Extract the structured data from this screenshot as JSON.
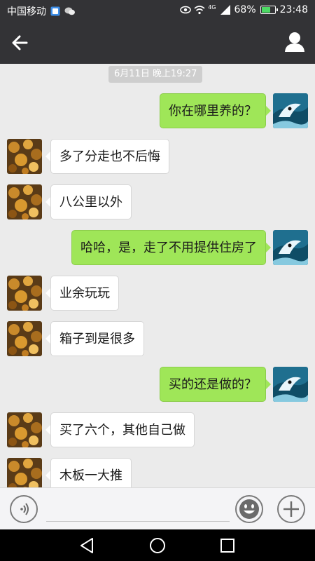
{
  "status_bar": {
    "carrier": "中国移动",
    "network": "4G",
    "battery": "68%",
    "battery_level": 0.68,
    "time": "23:48"
  },
  "header": {
    "contact_name": "",
    "icons": [
      "back-arrow-icon",
      "profile-icon"
    ]
  },
  "chat": {
    "timestamp": "6月11日 晚上19:27",
    "messages": [
      {
        "dir": "out",
        "text": "你在哪里养的？"
      },
      {
        "dir": "in",
        "text": "多了分走也不后悔"
      },
      {
        "dir": "in",
        "text": "八公里以外"
      },
      {
        "dir": "out",
        "text": "哈哈，是，走了不用提供住房了"
      },
      {
        "dir": "in",
        "text": "业余玩玩"
      },
      {
        "dir": "in",
        "text": "箱子到是很多"
      },
      {
        "dir": "out",
        "text": "买的还是做的？"
      },
      {
        "dir": "in",
        "text": "买了六个，其他自己做"
      },
      {
        "dir": "in",
        "text": "木板一大推"
      }
    ]
  },
  "input_bar": {
    "value": "",
    "icons": [
      "voice-icon",
      "emoji-icon",
      "plus-icon"
    ]
  },
  "nav_bar": {
    "icons": [
      "back-triangle-icon",
      "home-circle-icon",
      "recents-square-icon"
    ]
  },
  "colors": {
    "header_bg": "#333336",
    "chat_bg": "#ebebeb",
    "outgoing_bubble": "#9fe658",
    "incoming_bubble": "#ffffff"
  }
}
